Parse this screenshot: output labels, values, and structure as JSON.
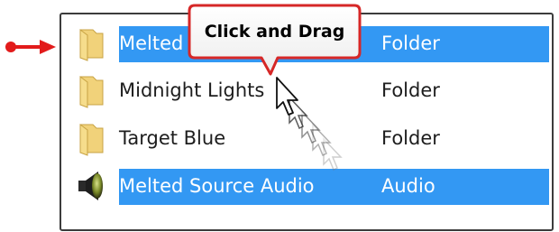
{
  "rows": [
    {
      "name": "Melted",
      "type": "Folder",
      "icon": "folder-icon",
      "selected": true
    },
    {
      "name": "Midnight Lights",
      "type": "Folder",
      "icon": "folder-icon",
      "selected": false
    },
    {
      "name": "Target Blue",
      "type": "Folder",
      "icon": "folder-icon",
      "selected": false
    },
    {
      "name": "Melted Source Audio",
      "type": "Audio",
      "icon": "speaker-icon",
      "selected": true
    }
  ],
  "callout": {
    "text": "Click and Drag"
  },
  "colors": {
    "selection": "#3398f3",
    "arrow": "#e21b1b",
    "callout_border": "#d62727"
  }
}
